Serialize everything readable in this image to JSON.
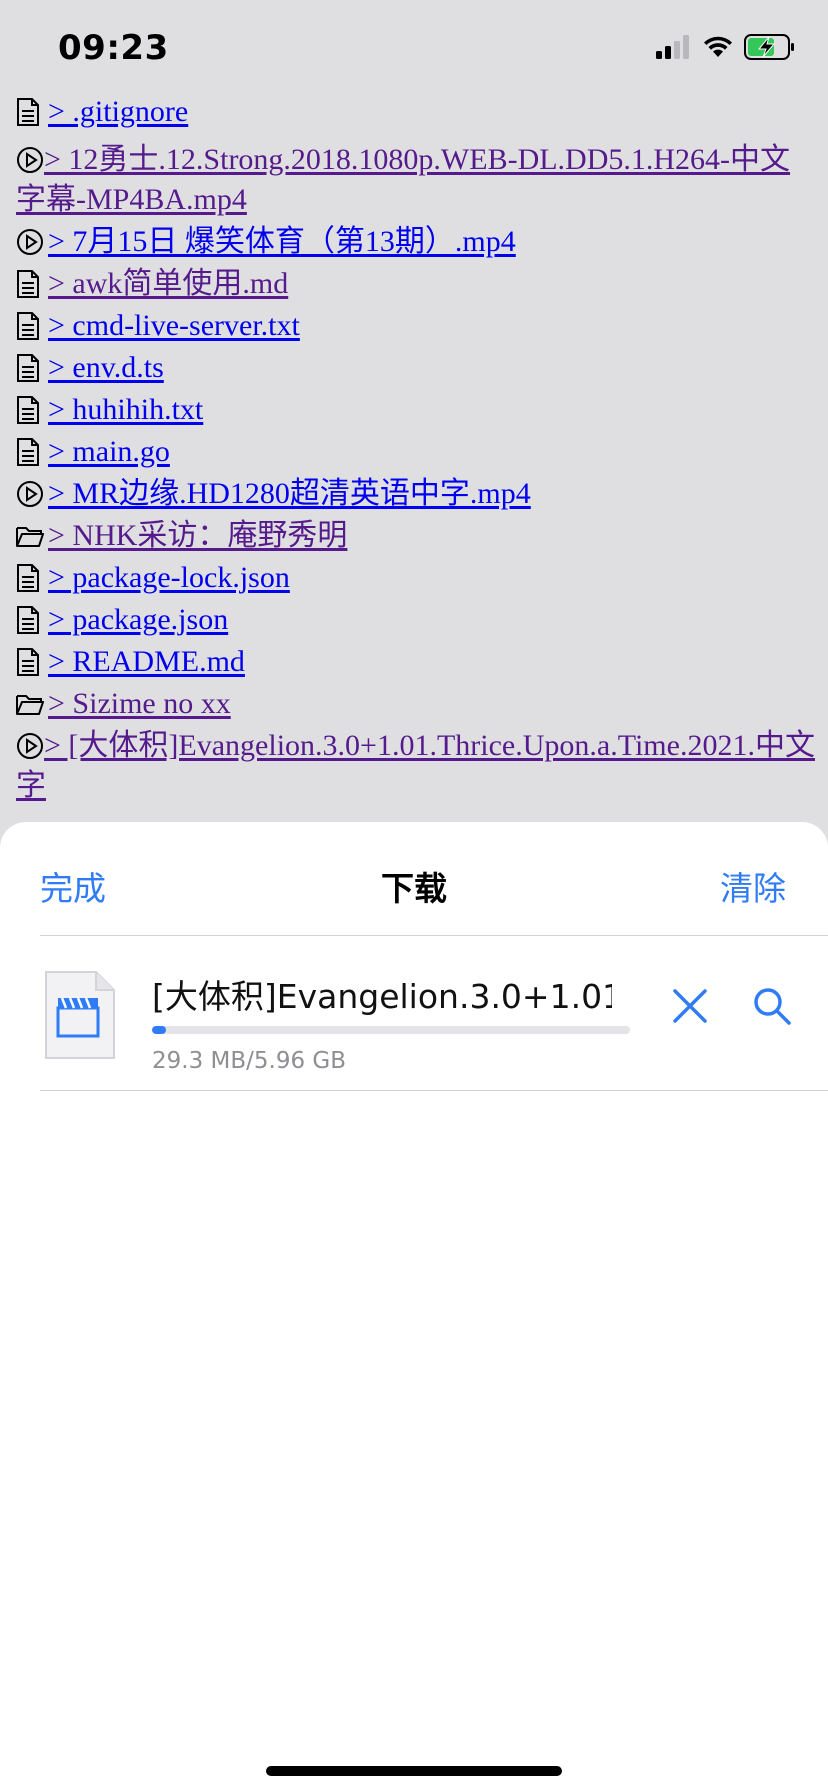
{
  "status_bar": {
    "time": "09:23"
  },
  "listing": {
    "items": [
      {
        "icon": "document-icon",
        "label": "> .gitignore"
      },
      {
        "icon": "play-icon",
        "label": "> 12勇士.12.Strong.2018.1080p.WEB-DL.DD5.1.H264-中文字幕-MP4BA.mp4"
      },
      {
        "icon": "play-icon",
        "label": "> 7月15日 爆笑体育（第13期）.mp4"
      },
      {
        "icon": "document-icon",
        "label": "> awk简单使用.md"
      },
      {
        "icon": "document-icon",
        "label": "> cmd-live-server.txt"
      },
      {
        "icon": "document-icon",
        "label": "> env.d.ts"
      },
      {
        "icon": "document-icon",
        "label": "> huhihih.txt"
      },
      {
        "icon": "document-icon",
        "label": "> main.go"
      },
      {
        "icon": "play-icon",
        "label": "> MR边缘.HD1280超清英语中字.mp4"
      },
      {
        "icon": "folder-icon",
        "label": "> NHK采访：庵野秀明"
      },
      {
        "icon": "document-icon",
        "label": "> package-lock.json"
      },
      {
        "icon": "document-icon",
        "label": "> package.json"
      },
      {
        "icon": "document-icon",
        "label": "> README.md"
      },
      {
        "icon": "folder-icon",
        "label": "> Sizime no xx"
      },
      {
        "icon": "play-icon",
        "label": "> [大体积]Evangelion.3.0+1.01.Thrice.Upon.a.Time.2021.中文字"
      }
    ]
  },
  "sheet": {
    "done_label": "完成",
    "title": "下载",
    "clear_label": "清除",
    "download": {
      "file_name": "[大体积]Evangelion.3.0+1.01....",
      "size_text": "29.3 MB/5.96 GB",
      "progress": 0.005,
      "icon": "video-file-icon"
    }
  },
  "colors": {
    "accent": "#2f7cf6",
    "link": "#0000ee",
    "visited": "#551a8b",
    "background": "#dfdfe2"
  }
}
